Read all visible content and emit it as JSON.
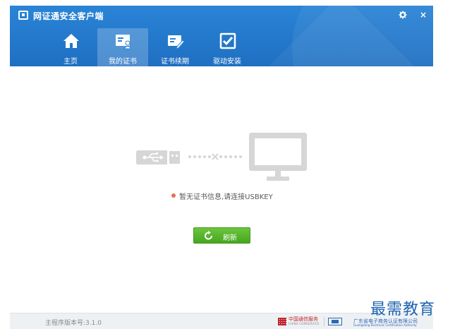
{
  "window": {
    "title": "网证通安全客户端",
    "settings_icon": "gear-icon",
    "close_icon": "×"
  },
  "nav": {
    "items": [
      {
        "label": "主页",
        "icon": "home-icon",
        "active": false
      },
      {
        "label": "我的证书",
        "icon": "certificate-user-icon",
        "active": true
      },
      {
        "label": "证书续期",
        "icon": "certificate-renew-icon",
        "active": false
      },
      {
        "label": "驱动安装",
        "icon": "checkbox-install-icon",
        "active": false
      }
    ]
  },
  "main": {
    "status_message": "暂无证书信息,请连接USBKEY",
    "status_color": "#e86f50",
    "refresh_label": "刷新"
  },
  "footer": {
    "version": "主程序版本号:3.1.0",
    "partner1_name": "中国通信服务",
    "partner1_sub": "CHINA COMSERVICE",
    "partner2_name": "广东省电子商务认证有限公司",
    "partner2_sub": "Guangdong Electronic Certification Authority"
  },
  "watermark": "最需教育",
  "colors": {
    "header_blue": "#2a84d6",
    "button_green": "#5cb82f",
    "icon_gray": "#d6d6d6"
  }
}
